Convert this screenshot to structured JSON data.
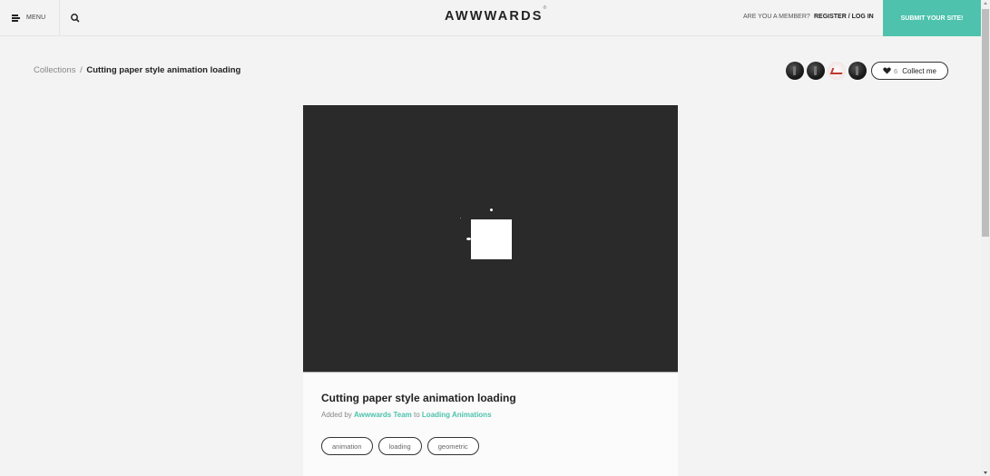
{
  "header": {
    "menu_label": "MENU",
    "logo": "AWWWARDS",
    "logo_mark": "®",
    "member_question": "ARE YOU A MEMBER?",
    "register_label": "REGISTER / LOG IN",
    "submit_label": "SUBMIT YOUR SITE!",
    "accent_color": "#4ec2ad"
  },
  "breadcrumb": {
    "parent": "Collections",
    "separator": "/",
    "current": "Cutting paper style animation loading"
  },
  "collectors": {
    "avatars": [
      "dark",
      "dark",
      "light",
      "dark"
    ],
    "count": "6",
    "collect_label": "Collect me"
  },
  "card": {
    "title": "Cutting paper style animation loading",
    "added_by_prefix": "Added by",
    "author": "Awwwards Team",
    "to_word": "to",
    "collection": "Loading Animations",
    "tags": [
      "animation",
      "loading",
      "geometric"
    ]
  }
}
